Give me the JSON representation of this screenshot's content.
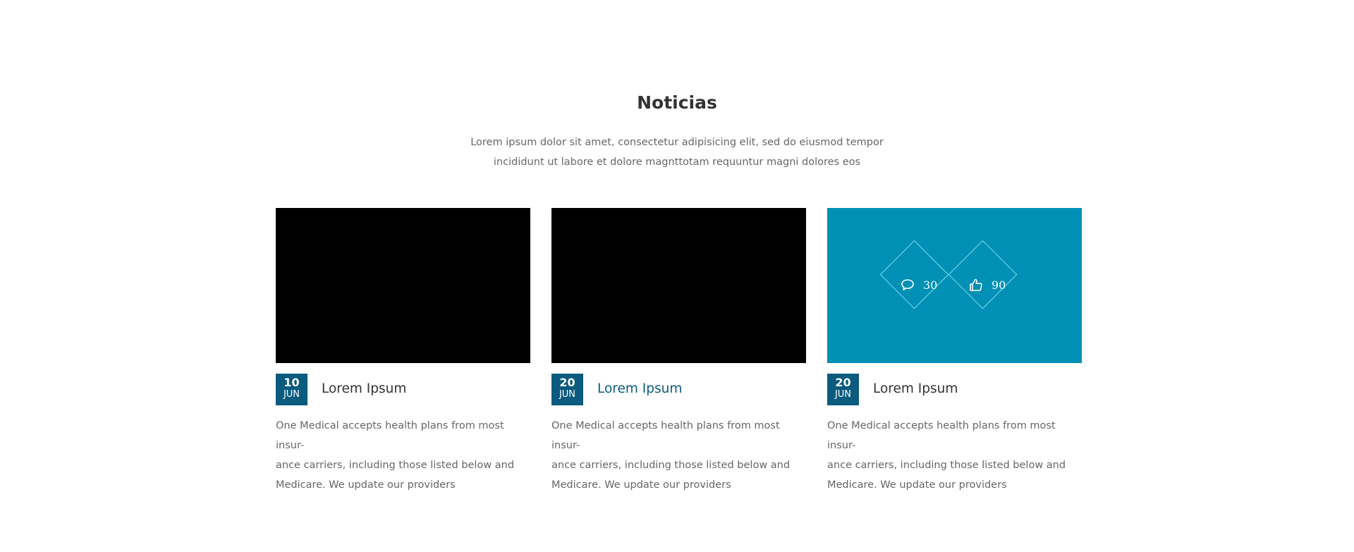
{
  "section": {
    "title": "Noticias",
    "subtitle_line1": "Lorem ipsum dolor sit amet, consectetur adipisicing elit, sed do eiusmod tempor",
    "subtitle_line2": "incididunt ut labore et dolore magnttotam requuntur magni dolores eos"
  },
  "cards": [
    {
      "day": "10",
      "month": "JUN",
      "title": "Lorem Ipsum",
      "text_line1": "One Medical accepts health plans from most insur-",
      "text_line2": "ance carriers, including those listed below and",
      "text_line3": "Medicare. We update our providers"
    },
    {
      "day": "20",
      "month": "JUN",
      "title": "Lorem Ipsum",
      "text_line1": "One Medical accepts health plans from most insur-",
      "text_line2": "ance carriers, including those listed below and",
      "text_line3": "Medicare. We update our providers"
    },
    {
      "day": "20",
      "month": "JUN",
      "title": "Lorem Ipsum",
      "text_line1": "One Medical accepts health plans from most insur-",
      "text_line2": "ance carriers, including those listed below and",
      "text_line3": "Medicare. We update our providers",
      "comments": "30",
      "likes": "90"
    }
  ],
  "icons": {
    "comments": "comment-icon",
    "likes": "thumbs-up-icon"
  },
  "colors": {
    "badge": "#0a5b7e",
    "active_title": "#0a5b7e",
    "overlay": "#0090b5",
    "diamond_border": "#7fdcf0"
  }
}
